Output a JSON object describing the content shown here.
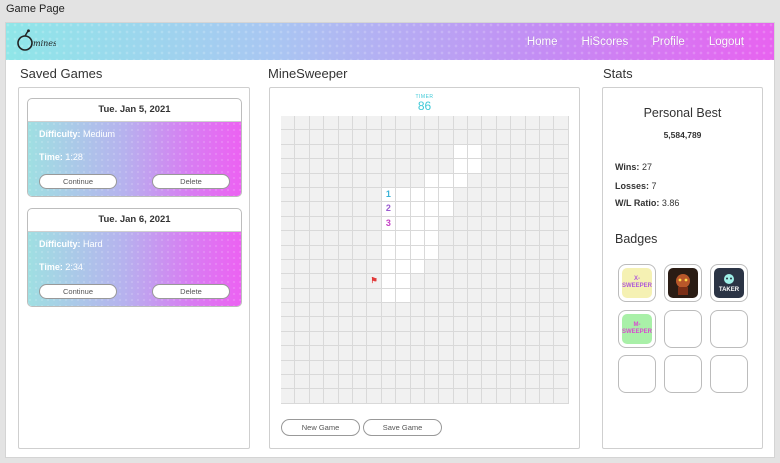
{
  "window": {
    "title": "Game Page"
  },
  "nav": {
    "logo_text": "mines",
    "links": [
      "Home",
      "HiScores",
      "Profile",
      "Logout"
    ]
  },
  "saved_games": {
    "title": "Saved Games",
    "cards": [
      {
        "date": "Tue. Jan 5, 2021",
        "difficulty_label": "Difficulty:",
        "difficulty": "Medium",
        "time_label": "Time:",
        "time": "1:28",
        "continue_label": "Continue",
        "delete_label": "Delete"
      },
      {
        "date": "Tue. Jan 6, 2021",
        "difficulty_label": "Difficulty:",
        "difficulty": "Hard",
        "time_label": "Time:",
        "time": "2:34",
        "continue_label": "Continue",
        "delete_label": "Delete"
      }
    ]
  },
  "minesweeper": {
    "title": "MineSweeper",
    "timer_label": "TIMER",
    "timer_value": "86",
    "new_game_label": "New Game",
    "save_game_label": "Save Game",
    "rows": 20,
    "cols": 20,
    "opened_cells": [
      [
        2,
        12
      ],
      [
        2,
        13
      ],
      [
        3,
        12
      ],
      [
        3,
        13
      ],
      [
        4,
        10
      ],
      [
        4,
        11
      ],
      [
        4,
        12
      ],
      [
        5,
        7
      ],
      [
        5,
        8
      ],
      [
        5,
        9
      ],
      [
        5,
        10
      ],
      [
        5,
        11
      ],
      [
        6,
        7
      ],
      [
        6,
        8
      ],
      [
        6,
        9
      ],
      [
        6,
        10
      ],
      [
        6,
        11
      ],
      [
        7,
        7
      ],
      [
        7,
        8
      ],
      [
        7,
        9
      ],
      [
        7,
        10
      ],
      [
        8,
        7
      ],
      [
        8,
        8
      ],
      [
        8,
        9
      ],
      [
        8,
        10
      ],
      [
        9,
        7
      ],
      [
        9,
        8
      ],
      [
        9,
        9
      ],
      [
        9,
        10
      ],
      [
        10,
        7
      ],
      [
        10,
        8
      ],
      [
        10,
        9
      ],
      [
        11,
        7
      ],
      [
        11,
        8
      ],
      [
        12,
        7
      ],
      [
        12,
        8
      ]
    ],
    "numbers": [
      {
        "r": 5,
        "c": 7,
        "v": "1"
      },
      {
        "r": 6,
        "c": 7,
        "v": "2"
      },
      {
        "r": 7,
        "c": 7,
        "v": "3"
      }
    ],
    "flags": [
      {
        "r": 11,
        "c": 6
      }
    ]
  },
  "stats": {
    "title": "Stats",
    "personal_best_label": "Personal Best",
    "personal_best": "5,584,789",
    "wins_label": "Wins:",
    "wins": "27",
    "losses_label": "Losses:",
    "losses": "7",
    "ratio_label": "W/L Ratio:",
    "ratio": "3.86",
    "badges_title": "Badges",
    "badges": [
      {
        "name": "x-sweeper-badge",
        "text": "X-SWEEPER",
        "earned": true,
        "color": "#f5f1b3"
      },
      {
        "name": "monster-badge",
        "text": "",
        "earned": true,
        "color": "#2a1c14"
      },
      {
        "name": "taker-badge",
        "text": "TAKER",
        "earned": true,
        "color": "#2b3445"
      },
      {
        "name": "m-sweeper-badge",
        "text": "M-SWEEPER",
        "earned": true,
        "color": "#a9f0a8"
      },
      {
        "name": "empty-badge",
        "text": "",
        "earned": false
      },
      {
        "name": "empty-badge",
        "text": "",
        "earned": false
      },
      {
        "name": "empty-badge",
        "text": "",
        "earned": false
      },
      {
        "name": "empty-badge",
        "text": "",
        "earned": false
      },
      {
        "name": "empty-badge",
        "text": "",
        "earned": false
      }
    ]
  }
}
